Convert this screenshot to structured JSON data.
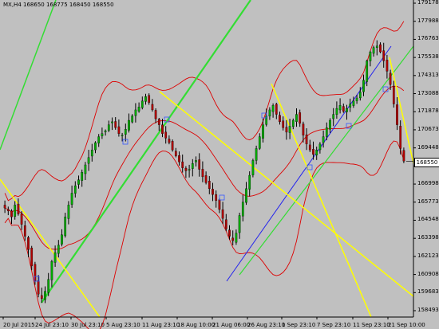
{
  "window": {
    "title": "MX,H4  168650 168775 168450 168550"
  },
  "price_axis": {
    "labels": [
      "179178",
      "177988",
      "176763",
      "175538",
      "174313",
      "173088",
      "171878",
      "170673",
      "169448",
      "168223",
      "166998",
      "165773",
      "164548",
      "163398",
      "162123",
      "160908",
      "159683",
      "158493"
    ],
    "current_price": "168550"
  },
  "time_axis": {
    "labels": [
      "20 Jul 2015",
      "24 Jul 23:10",
      "30 Jul 23:10",
      "5 Aug 23:10",
      "11 Aug 23:10",
      "18 Aug 10:00",
      "21 Aug 06:00",
      "26 Aug 23:10",
      "1 Sep 23:10",
      "7 Sep 23:10",
      "11 Sep 23:10",
      "21 Sep 10:00"
    ]
  },
  "colors": {
    "background": "#c0c0c0",
    "candle_up": "#00aa00",
    "candle_down": "#b00000",
    "wick": "#000000",
    "bollinger": "#dd0000",
    "channel_green": "#33dd33",
    "channel_yellow": "#ffff00",
    "trendline_blue": "#2222ee"
  },
  "chart_data": {
    "type": "candlestick",
    "symbol": "MX",
    "timeframe": "H4",
    "ohlc_header": {
      "open": 168650,
      "high": 168775,
      "low": 168450,
      "close": 168550
    },
    "y_range": [
      158493,
      179178
    ],
    "close_series": [
      165400,
      165200,
      164800,
      165600,
      165000,
      164300,
      163500,
      162600,
      161500,
      160500,
      159600,
      159300,
      159800,
      160600,
      161800,
      162400,
      162900,
      163600,
      164800,
      165600,
      166400,
      166900,
      167300,
      167800,
      168300,
      168800,
      169300,
      169800,
      170200,
      170400,
      170600,
      171000,
      171200,
      170800,
      170400,
      170300,
      170700,
      171300,
      171600,
      172000,
      172200,
      172600,
      172900,
      172500,
      172000,
      171400,
      171000,
      170400,
      170100,
      169800,
      169300,
      168900,
      168500,
      168100,
      167900,
      168000,
      168400,
      168600,
      168000,
      167500,
      167100,
      166700,
      166300,
      165900,
      165300,
      164700,
      164000,
      163500,
      163200,
      163700,
      164900,
      165800,
      166700,
      167600,
      168600,
      169400,
      170200,
      171000,
      171600,
      172000,
      172300,
      171700,
      171200,
      170800,
      170500,
      170900,
      171300,
      171700,
      171100,
      170300,
      169700,
      169300,
      169000,
      169300,
      169700,
      170200,
      170800,
      171300,
      171700,
      172100,
      172300,
      171900,
      172100,
      172400,
      172600,
      172800,
      173200,
      174000,
      175300,
      175900,
      176200,
      176300,
      175900,
      175300,
      174600,
      173700,
      172400,
      171000,
      169400,
      168550
    ]
  }
}
